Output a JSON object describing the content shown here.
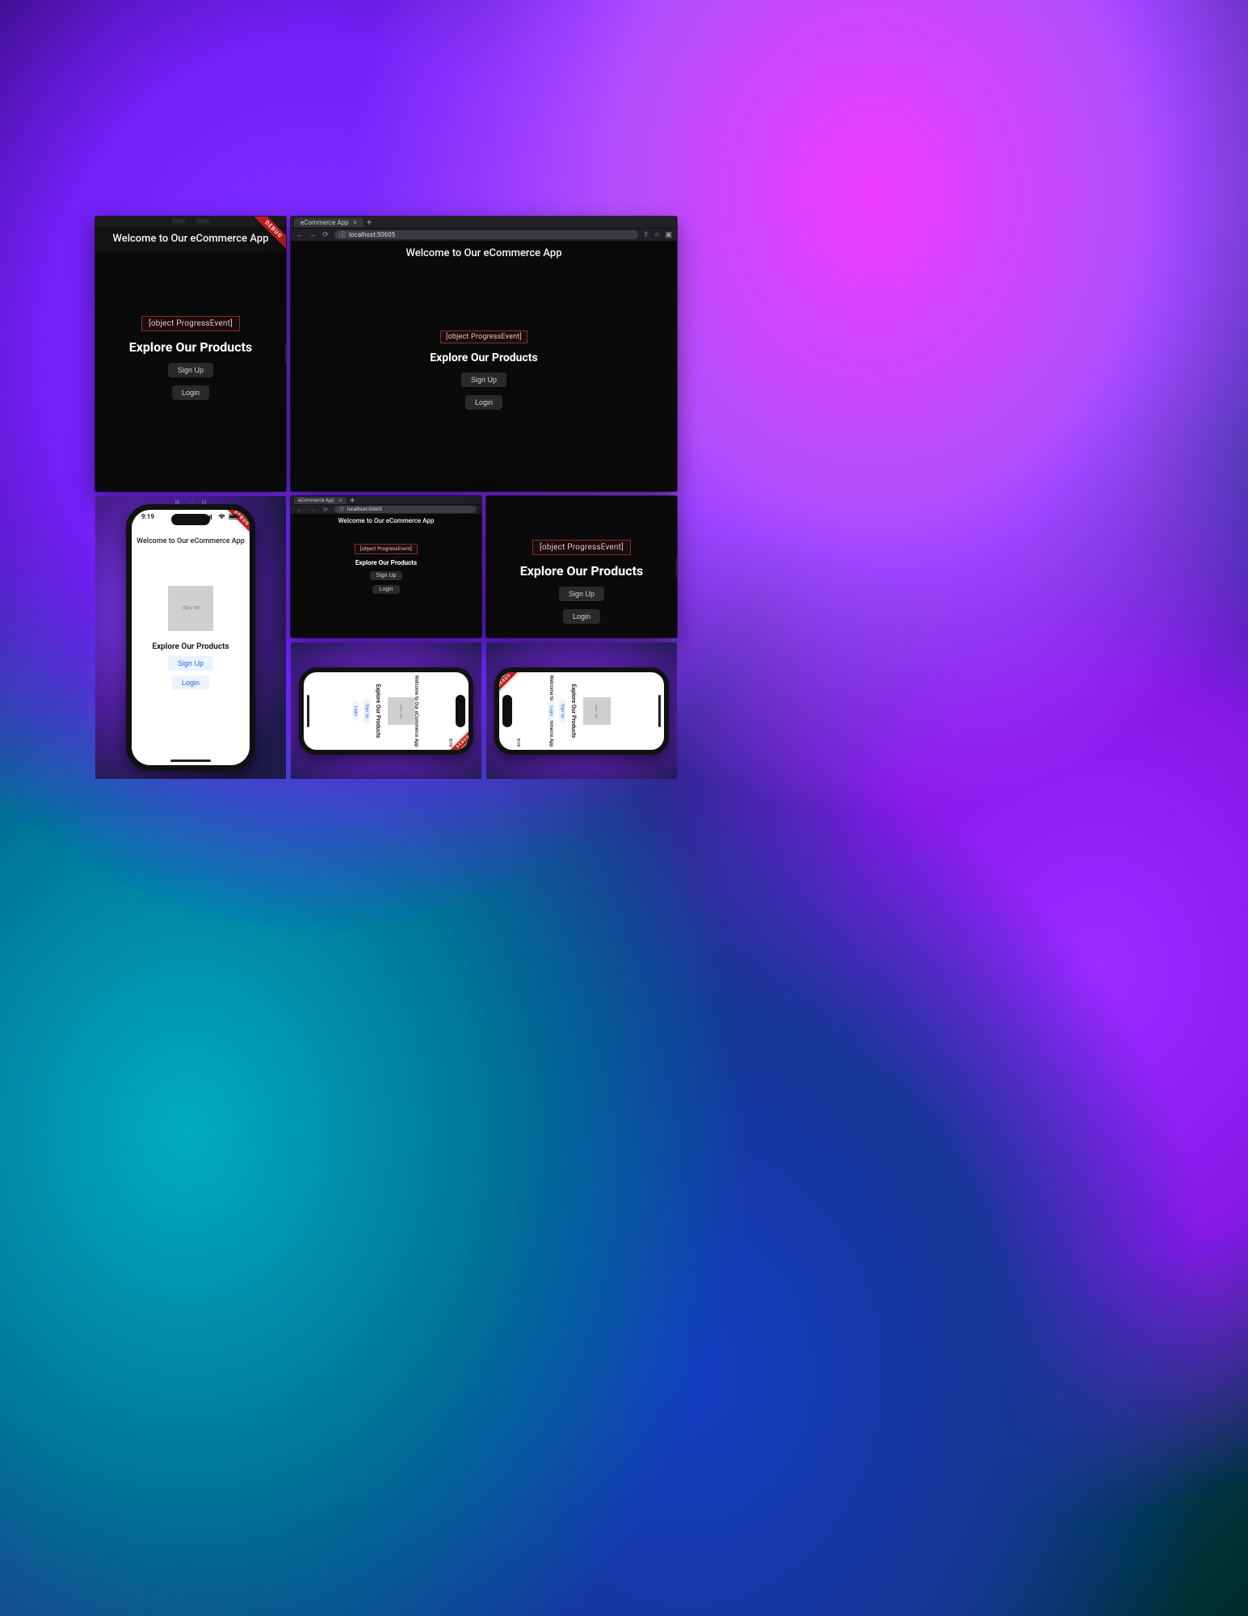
{
  "app": {
    "title": "Welcome to Our eCommerce App",
    "headline": "Explore Our Products",
    "signup_label": "Sign Up",
    "login_label": "Login",
    "error_text": "[object ProgressEvent]",
    "debug_label": "DEBUG",
    "placeholder_label": "150 x 150"
  },
  "browser": {
    "tab_title": "eCommerce App",
    "url_prefix_icon": "ⓘ",
    "url": "localhost:50605",
    "close_glyph": "×",
    "newtab_glyph": "+",
    "back_glyph": "←",
    "fwd_glyph": "→",
    "reload_glyph": "⟳",
    "share_glyph": "⇪",
    "star_glyph": "☆",
    "ext_glyph": "▣"
  },
  "phone": {
    "time": "9:19",
    "signal_icon": "signal-icon",
    "wifi_icon": "wifi-icon",
    "battery_icon": "battery-icon"
  }
}
